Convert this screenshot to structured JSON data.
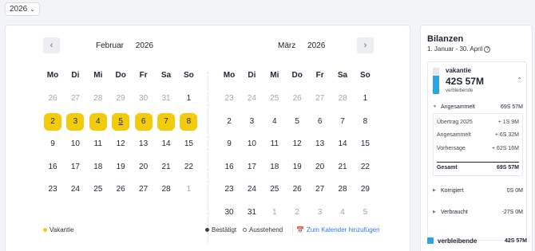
{
  "year_select": {
    "value": "2026",
    "icon": "chevron-down-icon"
  },
  "february": {
    "month": "Februar",
    "year": "2026",
    "weekdays": [
      "Mo",
      "Di",
      "Mi",
      "Do",
      "Fr",
      "Sa",
      "So"
    ],
    "weeks": [
      [
        {
          "d": "26",
          "o": true
        },
        {
          "d": "27",
          "o": true
        },
        {
          "d": "28",
          "o": true
        },
        {
          "d": "29",
          "o": true
        },
        {
          "d": "30",
          "o": true
        },
        {
          "d": "31",
          "o": true
        },
        {
          "d": "1"
        }
      ],
      [
        {
          "d": "2",
          "v": true
        },
        {
          "d": "3",
          "v": true
        },
        {
          "d": "4",
          "v": true
        },
        {
          "d": "5",
          "v": true,
          "t": true
        },
        {
          "d": "6",
          "v": true
        },
        {
          "d": "7",
          "v": true
        },
        {
          "d": "8",
          "v": true
        }
      ],
      [
        {
          "d": "9"
        },
        {
          "d": "10"
        },
        {
          "d": "11"
        },
        {
          "d": "12"
        },
        {
          "d": "13"
        },
        {
          "d": "14"
        },
        {
          "d": "15"
        }
      ],
      [
        {
          "d": "16"
        },
        {
          "d": "17"
        },
        {
          "d": "18"
        },
        {
          "d": "19"
        },
        {
          "d": "20"
        },
        {
          "d": "21"
        },
        {
          "d": "22"
        }
      ],
      [
        {
          "d": "23"
        },
        {
          "d": "24"
        },
        {
          "d": "25"
        },
        {
          "d": "26"
        },
        {
          "d": "27"
        },
        {
          "d": "28"
        },
        {
          "d": "1",
          "o": true
        }
      ]
    ]
  },
  "march": {
    "month": "März",
    "year": "2026",
    "weekdays": [
      "Mo",
      "Di",
      "Mi",
      "Do",
      "Fr",
      "Sa",
      "So"
    ],
    "weeks": [
      [
        {
          "d": "23",
          "o": true
        },
        {
          "d": "24",
          "o": true
        },
        {
          "d": "25",
          "o": true
        },
        {
          "d": "26",
          "o": true
        },
        {
          "d": "27",
          "o": true
        },
        {
          "d": "28",
          "o": true
        },
        {
          "d": "1"
        }
      ],
      [
        {
          "d": "2"
        },
        {
          "d": "3"
        },
        {
          "d": "4"
        },
        {
          "d": "5"
        },
        {
          "d": "6"
        },
        {
          "d": "7"
        },
        {
          "d": "8"
        }
      ],
      [
        {
          "d": "9"
        },
        {
          "d": "10"
        },
        {
          "d": "11"
        },
        {
          "d": "12"
        },
        {
          "d": "13"
        },
        {
          "d": "14"
        },
        {
          "d": "15"
        }
      ],
      [
        {
          "d": "16"
        },
        {
          "d": "17"
        },
        {
          "d": "18"
        },
        {
          "d": "19"
        },
        {
          "d": "20"
        },
        {
          "d": "21"
        },
        {
          "d": "22"
        }
      ],
      [
        {
          "d": "23"
        },
        {
          "d": "24"
        },
        {
          "d": "25"
        },
        {
          "d": "26"
        },
        {
          "d": "27"
        },
        {
          "d": "28"
        },
        {
          "d": "29"
        }
      ],
      [
        {
          "d": "30"
        },
        {
          "d": "31"
        },
        {
          "d": "1",
          "o": true
        },
        {
          "d": "2",
          "o": true
        },
        {
          "d": "3",
          "o": true
        },
        {
          "d": "4",
          "o": true
        },
        {
          "d": "5",
          "o": true
        }
      ]
    ]
  },
  "legend": {
    "vacation": "Vakantie",
    "confirmed": "Bestätigt",
    "pending": "Ausstehend",
    "add_calendar": "Zum Kalender hinzufügen"
  },
  "balances": {
    "title": "Bilanzen",
    "range": "1. Januar - 30. April",
    "type_name": "vakantie",
    "amount": "42S 57M",
    "remaining_label": "verbleibende",
    "accrued_label": "Angesammelt",
    "accrued_value": "69S 57M",
    "details": [
      {
        "label": "Übertrag 2025",
        "value": "+ 1S 9M"
      },
      {
        "label": "Angesammelt",
        "value": "+ 6S 32M"
      },
      {
        "label": "Vorhersage",
        "value": "+ 62S 16M"
      }
    ],
    "total_label": "Gesamt",
    "total_value": "69S 57M",
    "corrected_label": "Korrigiert",
    "corrected_value": "0S 0M",
    "used_label": "Verbraucht",
    "used_value": "-27S 0M",
    "remaining_row_label": "verbleibende",
    "remaining_row_value": "42S 57M"
  },
  "colors": {
    "vacation": "#f2cc0c",
    "accent": "#2ba4e0",
    "link": "#2b7de9"
  }
}
